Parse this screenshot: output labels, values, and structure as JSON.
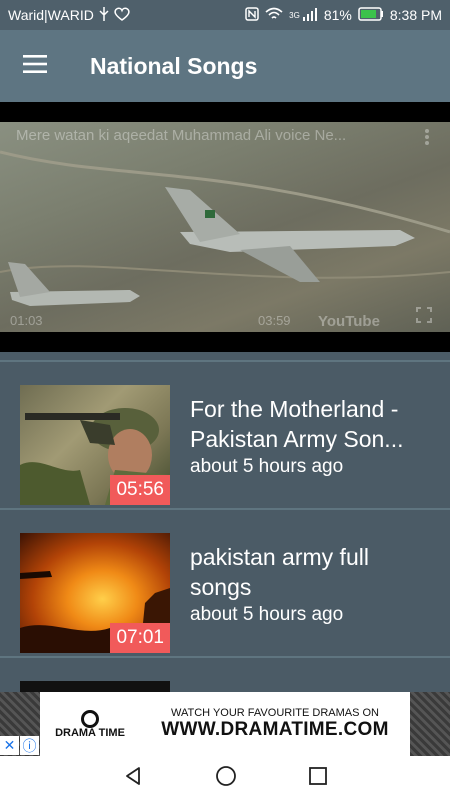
{
  "status_bar": {
    "carrier": "Warid|WARID",
    "network_type": "3G",
    "battery": "81%",
    "time": "8:38 PM"
  },
  "app_bar": {
    "title": "National Songs",
    "menu_icon": "hamburger-menu-icon"
  },
  "player": {
    "video_title": "Mere watan ki aqeedat Muhammad Ali voice Ne...",
    "time_a": "01:03",
    "time_b": "03:59",
    "logo_text": "YouTube"
  },
  "videos": [
    {
      "title": "For the Motherland - Pakistan Army Son...",
      "time_ago": "about 5 hours ago",
      "duration": "05:56"
    },
    {
      "title": "pakistan army full songs",
      "time_ago": "about 5 hours ago",
      "duration": "07:01"
    },
    {
      "title": "",
      "time_ago": "",
      "duration": ""
    }
  ],
  "ad": {
    "logo_text": "DRAMA TIME",
    "line1": "WATCH YOUR FAVOURITE DRAMAS ON",
    "line2": "WWW.DRAMATIME.COM",
    "close_icon": "close-icon",
    "info_icon": "info-icon"
  },
  "nav_bar": {
    "back_icon": "back-icon",
    "home_icon": "home-icon",
    "recents_icon": "recents-icon"
  },
  "colors": {
    "app_bar": "#5e7582",
    "background": "#4b5b66",
    "duration_badge": "#f15a5a"
  }
}
